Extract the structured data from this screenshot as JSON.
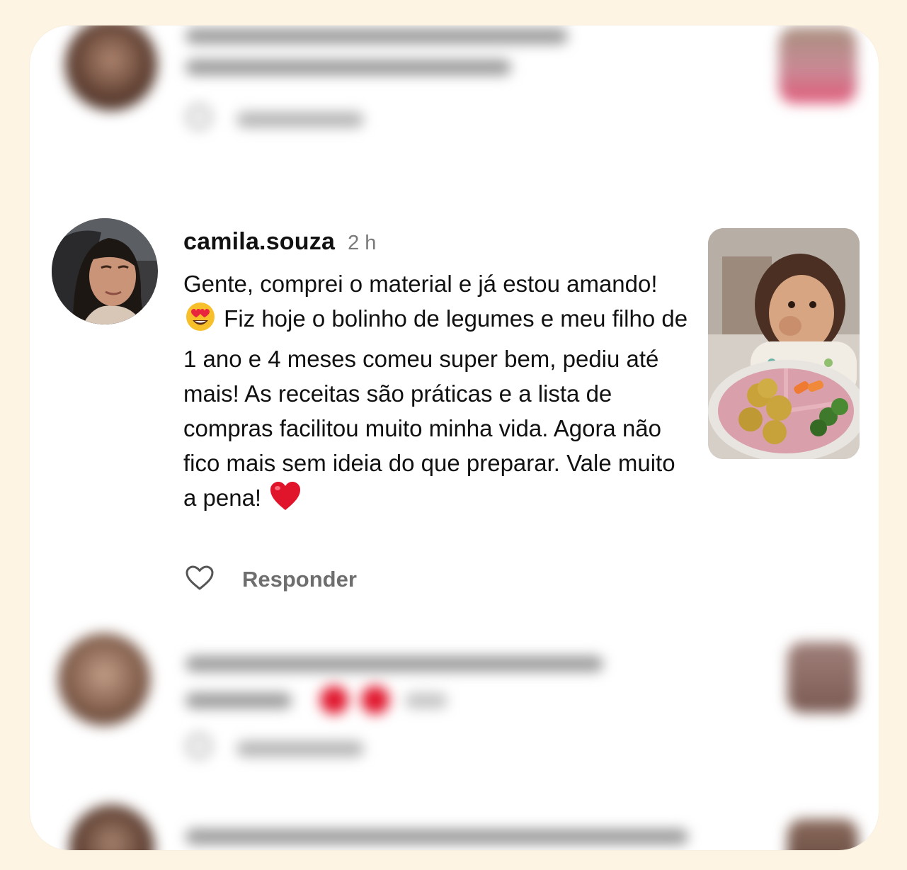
{
  "comment": {
    "username": "camila.souza",
    "timestamp": "2 h",
    "text_part1": "Gente, comprei o material e já estou amando! ",
    "emoji1": "😍",
    "text_part2": " Fiz hoje o bolinho de legumes e meu filho de 1 ano e 4 meses comeu super bem, pediu até mais! As receitas são práticas e a lista de compras facilitou muito minha vida. Agora não fico mais sem ideia do que preparar. Vale muito a pena! ",
    "emoji2": "❤️",
    "reply_label": "Responder"
  },
  "icons": {
    "like": "heart-outline-icon"
  },
  "colors": {
    "page_background": "#fdf4e3",
    "card_background": "#ffffff",
    "text": "#111111",
    "muted": "#7a7a7a"
  }
}
